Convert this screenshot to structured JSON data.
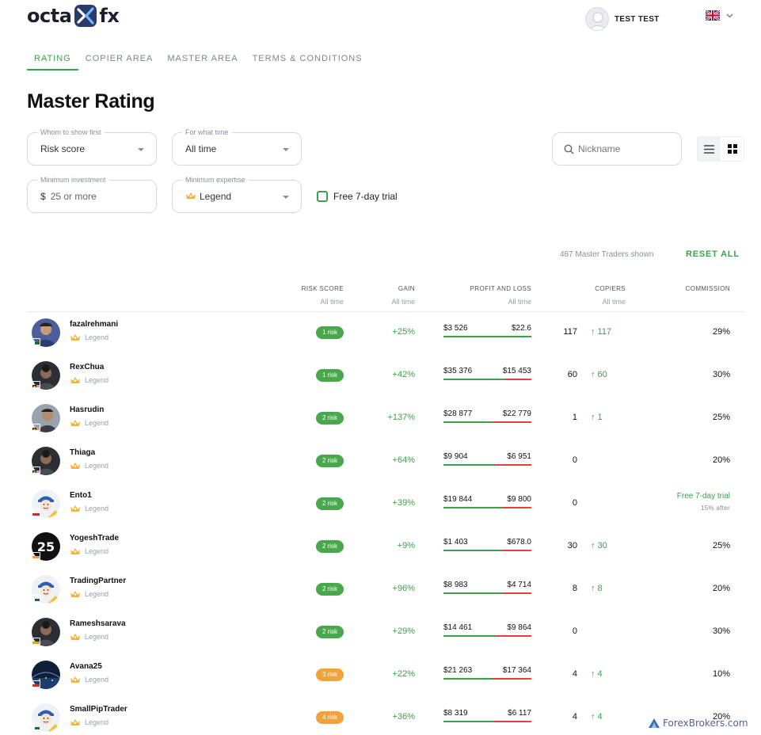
{
  "header": {
    "logo_left": "octa",
    "logo_right": "fx",
    "user_name": "TEST TEST",
    "language": "English (UK)"
  },
  "tabs": [
    "RATING",
    "COPIER AREA",
    "MASTER AREA",
    "TERMS & CONDITIONS"
  ],
  "page_title": "Master Rating",
  "filters": {
    "whom_label": "Whom to show first",
    "whom_value": "Risk score",
    "time_label": "For what time",
    "time_value": "All time",
    "investment_label": "Minimum investment",
    "investment_currency": "$",
    "investment_value": "25 or more",
    "expertise_label": "Minimum expertise",
    "expertise_value": "Legend",
    "search_placeholder": "Nickname",
    "trial_label": "Free 7-day trial"
  },
  "summary": {
    "shown": "487 Master Traders shown",
    "reset": "RESET ALL"
  },
  "columns": {
    "risk": "RISK SCORE",
    "risk_sub": "All time",
    "gain": "GAIN",
    "gain_sub": "All time",
    "pnl": "PROFIT AND LOSS",
    "pnl_sub": "All time",
    "copiers": "COPIERS",
    "copiers_sub": "All time",
    "commission": "COMMISSION"
  },
  "rows": [
    {
      "nick": "fazalrehmani",
      "level": "Legend",
      "risk": "1 risk",
      "gain": "+25%",
      "profit": "$3 526",
      "loss": "$22.6",
      "copiers": "117",
      "copiers_up": "↑ 117",
      "commission": "29%"
    },
    {
      "nick": "RexChua",
      "level": "Legend",
      "risk": "1 risk",
      "gain": "+42%",
      "profit": "$35 376",
      "loss": "$15 453",
      "copiers": "60",
      "copiers_up": "↑ 60",
      "commission": "30%"
    },
    {
      "nick": "Hasrudin",
      "level": "Legend",
      "risk": "2 risk",
      "gain": "+137%",
      "profit": "$28 877",
      "loss": "$22 779",
      "copiers": "1",
      "copiers_up": "↑ 1",
      "commission": "25%"
    },
    {
      "nick": "Thiaga",
      "level": "Legend",
      "risk": "2 risk",
      "gain": "+64%",
      "profit": "$9 904",
      "loss": "$6 951",
      "copiers": "0",
      "copiers_up": "",
      "commission": "20%"
    },
    {
      "nick": "Ento1",
      "level": "Legend",
      "risk": "2 risk",
      "gain": "+39%",
      "profit": "$19 844",
      "loss": "$9 800",
      "copiers": "0",
      "copiers_up": "",
      "commission": "",
      "trial": "Free 7-day trial",
      "trial_after": "15%  after"
    },
    {
      "nick": "YogeshTrade",
      "level": "Legend",
      "risk": "2 risk",
      "gain": "+9%",
      "profit": "$1 403",
      "loss": "$678.0",
      "copiers": "30",
      "copiers_up": "↑ 30",
      "commission": "25%"
    },
    {
      "nick": "TradingPartner",
      "level": "Legend",
      "risk": "2 risk",
      "gain": "+96%",
      "profit": "$8 983",
      "loss": "$4 714",
      "copiers": "8",
      "copiers_up": "↑ 8",
      "commission": "20%"
    },
    {
      "nick": "Rameshsarava",
      "level": "Legend",
      "risk": "2 risk",
      "gain": "+29%",
      "profit": "$14 461",
      "loss": "$9 864",
      "copiers": "0",
      "copiers_up": "",
      "commission": "30%"
    },
    {
      "nick": "Avana25",
      "level": "Legend",
      "risk": "3 risk",
      "gain": "+22%",
      "profit": "$21 263",
      "loss": "$17 364",
      "copiers": "4",
      "copiers_up": "↑ 4",
      "commission": "10%"
    },
    {
      "nick": "SmallPipTrader",
      "level": "Legend",
      "risk": "4 risk",
      "gain": "+36%",
      "profit": "$8 319",
      "loss": "$6 117",
      "copiers": "4",
      "copiers_up": "↑ 4",
      "commission": "20%"
    }
  ],
  "row_meta": [
    {
      "flag": "pk",
      "avatar": "photo-blue",
      "risk_color": "green",
      "profit_share": 0.99
    },
    {
      "flag": "my",
      "avatar": "photo-dark",
      "risk_color": "green",
      "profit_share": 0.7
    },
    {
      "flag": "my",
      "avatar": "photo-gray",
      "risk_color": "green",
      "profit_share": 0.56
    },
    {
      "flag": "my",
      "avatar": "photo-dark",
      "risk_color": "green",
      "profit_share": 0.59
    },
    {
      "flag": "id",
      "avatar": "cartoon",
      "risk_color": "green",
      "profit_share": 0.67
    },
    {
      "flag": "in",
      "avatar": "badge-25",
      "risk_color": "green",
      "profit_share": 0.67
    },
    {
      "flag": "pk",
      "avatar": "cartoon",
      "risk_color": "green",
      "profit_share": 0.66
    },
    {
      "flag": "in",
      "avatar": "photo-dark",
      "risk_color": "green",
      "profit_share": 0.59
    },
    {
      "flag": "id",
      "avatar": "photo-night",
      "risk_color": "orange",
      "profit_share": 0.55
    },
    {
      "flag": "pk",
      "avatar": "cartoon",
      "risk_color": "orange",
      "profit_share": 0.58
    }
  ],
  "colors": {
    "accent": "#3aa24a",
    "loss": "#e0443a",
    "risk_green": "#48a84b",
    "risk_orange": "#f1a33a"
  },
  "watermark": "ForexBrokers.com"
}
